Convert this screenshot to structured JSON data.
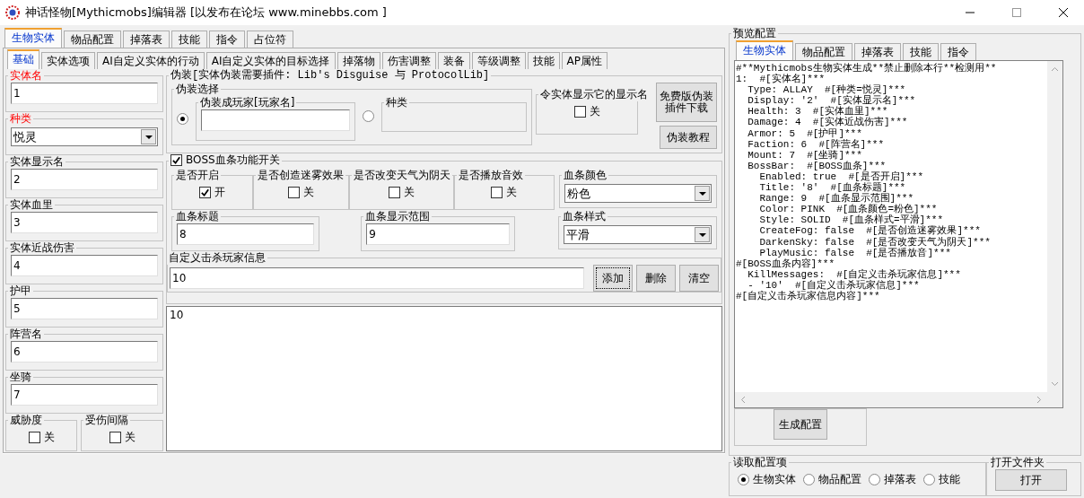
{
  "window": {
    "title": "神话怪物[Mythicmobs]编辑器 [以发布在论坛 www.minebbs.com ]"
  },
  "main_tabs": [
    {
      "label": "生物实体",
      "selected": true
    },
    {
      "label": "物品配置",
      "selected": false
    },
    {
      "label": "掉落表",
      "selected": false
    },
    {
      "label": "技能",
      "selected": false
    },
    {
      "label": "指令",
      "selected": false
    },
    {
      "label": "占位符",
      "selected": false
    }
  ],
  "sub_tabs": [
    {
      "label": "基础",
      "selected": true
    },
    {
      "label": "实体选项",
      "selected": false
    },
    {
      "label": "AI自定义实体的行动",
      "selected": false
    },
    {
      "label": "AI自定义实体的目标选择",
      "selected": false
    },
    {
      "label": "掉落物",
      "selected": false
    },
    {
      "label": "伤害调整",
      "selected": false
    },
    {
      "label": "装备",
      "selected": false
    },
    {
      "label": "等级调整",
      "selected": false
    },
    {
      "label": "技能",
      "selected": false
    },
    {
      "label": "AP属性",
      "selected": false
    }
  ],
  "left_fields": [
    {
      "label": "实体名",
      "value": "1",
      "kind": "text",
      "required": true
    },
    {
      "label": "种类",
      "value": "悦灵",
      "kind": "select",
      "required": true
    },
    {
      "label": "实体显示名",
      "value": "2",
      "kind": "text",
      "required": false
    },
    {
      "label": "实体血里",
      "value": "3",
      "kind": "text",
      "required": false
    },
    {
      "label": "实体近战伤害",
      "value": "4",
      "kind": "text",
      "required": false
    },
    {
      "label": "护甲",
      "value": "5",
      "kind": "text",
      "required": false
    },
    {
      "label": "阵营名",
      "value": "6",
      "kind": "text",
      "required": false
    },
    {
      "label": "坐骑",
      "value": "7",
      "kind": "text",
      "required": false
    }
  ],
  "left_toggles": [
    {
      "label": "威胁度",
      "text": "关",
      "checked": false
    },
    {
      "label": "受伤间隔",
      "text": "关",
      "checked": false
    }
  ],
  "disguise": {
    "title": "伪装[实体伪装需要插件: Lib's Disguise 与 ProtocolLib]",
    "select_title": "伪装选择",
    "options": [
      {
        "label": "伪装成玩家[玩家名]",
        "kind": "player",
        "selected": true
      },
      {
        "label": "种类",
        "kind": "type",
        "selected": false
      }
    ],
    "show_name": {
      "label": "令实体显示它的显示名",
      "text": "关",
      "checked": false
    },
    "buttons": [
      "免费版伪装插件下载",
      "伪装教程"
    ]
  },
  "bossbar": {
    "label": "BOSS血条功能开关",
    "checked": true,
    "toggles": [
      {
        "label": "是否开启",
        "text": "开",
        "checked": true
      },
      {
        "label": "是否创造迷雾效果",
        "text": "关",
        "checked": false
      },
      {
        "label": "是否改变天气为阴天",
        "text": "关",
        "checked": false
      },
      {
        "label": "是否播放音效",
        "text": "关",
        "checked": false
      }
    ],
    "color": {
      "label": "血条颜色",
      "value": "粉色"
    },
    "title": {
      "label": "血条标题",
      "value": "8"
    },
    "range": {
      "label": "血条显示范围",
      "value": "9"
    },
    "style": {
      "label": "血条样式",
      "value": "平滑"
    }
  },
  "kill_messages": {
    "label": "自定义击杀玩家信息",
    "value": "10",
    "buttons": [
      {
        "label": "添加",
        "focused": true
      },
      {
        "label": "删除",
        "focused": false
      },
      {
        "label": "清空",
        "focused": false
      }
    ],
    "list": [
      "10"
    ]
  },
  "preview": {
    "title": "预览配置",
    "tabs": [
      {
        "label": "生物实体",
        "selected": true
      },
      {
        "label": "物品配置",
        "selected": false
      },
      {
        "label": "掉落表",
        "selected": false
      },
      {
        "label": "技能",
        "selected": false
      },
      {
        "label": "指令",
        "selected": false
      }
    ],
    "lines": [
      "#**Mythicmobs生物实体生成**禁止删除本行**检测用**",
      "1:  #[实体名]***",
      "  Type: ALLAY  #[种类=悦灵]***",
      "  Display: '2'  #[实体显示名]***",
      "  Health: 3  #[实体血里]***",
      "  Damage: 4  #[实体近战伤害]***",
      "  Armor: 5  #[护甲]***",
      "  Faction: 6  #[阵营名]***",
      "  Mount: 7  #[坐骑]***",
      "  BossBar:  #[BOSS血条]***",
      "    Enabled: true  #[是否开启]***",
      "    Title: '8'  #[血条标题]***",
      "    Range: 9  #[血条显示范围]***",
      "    Color: PINK  #[血条颜色=粉色]***",
      "    Style: SOLID  #[血条样式=平滑]***",
      "    CreateFog: false  #[是否创造迷雾效果]***",
      "    DarkenSky: false  #[是否改变天气为阴天]***",
      "    PlayMusic: false  #[是否播放音]***",
      "#[BOSS血条内容]***",
      "  KillMessages:  #[自定义击杀玩家信息]***",
      "  - '10'  #[自定义击杀玩家信息]***",
      "#[自定义击杀玩家信息内容]***"
    ],
    "button": "生成配置"
  },
  "load": {
    "title": "读取配置项",
    "options": [
      {
        "label": "生物实体",
        "selected": true
      },
      {
        "label": "物品配置",
        "selected": false
      },
      {
        "label": "掉落表",
        "selected": false
      },
      {
        "label": "技能",
        "selected": false
      }
    ]
  },
  "open_folder": {
    "title": "打开文件夹",
    "button": "打开"
  }
}
